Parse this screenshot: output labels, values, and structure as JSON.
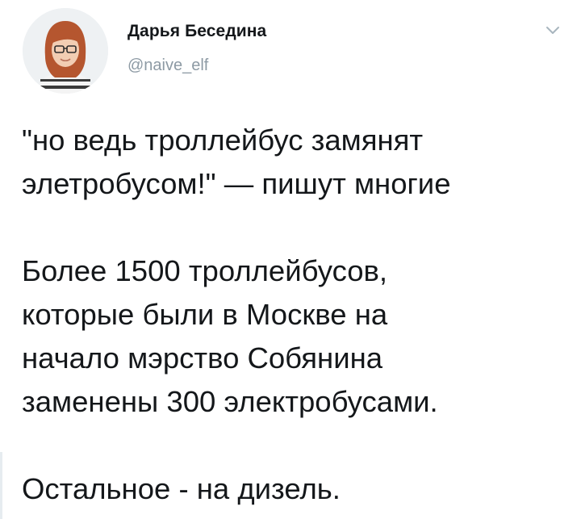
{
  "tweet": {
    "author": {
      "display_name": "Дарья Беседина",
      "handle": "@naive_elf",
      "avatar_icon": "user-avatar-photo"
    },
    "menu_icon": "chevron-down-icon",
    "paragraphs": [
      "\"но ведь троллейбус замянят\nэлетробусом!\" — пишут многие",
      "Более 1500 троллейбусов,\nкоторые были в Москве на\nначало мэрство Собянина\nзаменены 300 электробусами.",
      "Остальное - на дизель."
    ]
  },
  "colors": {
    "text": "#14171a",
    "muted": "#8d9aa4",
    "chevron": "#a8b5be"
  }
}
